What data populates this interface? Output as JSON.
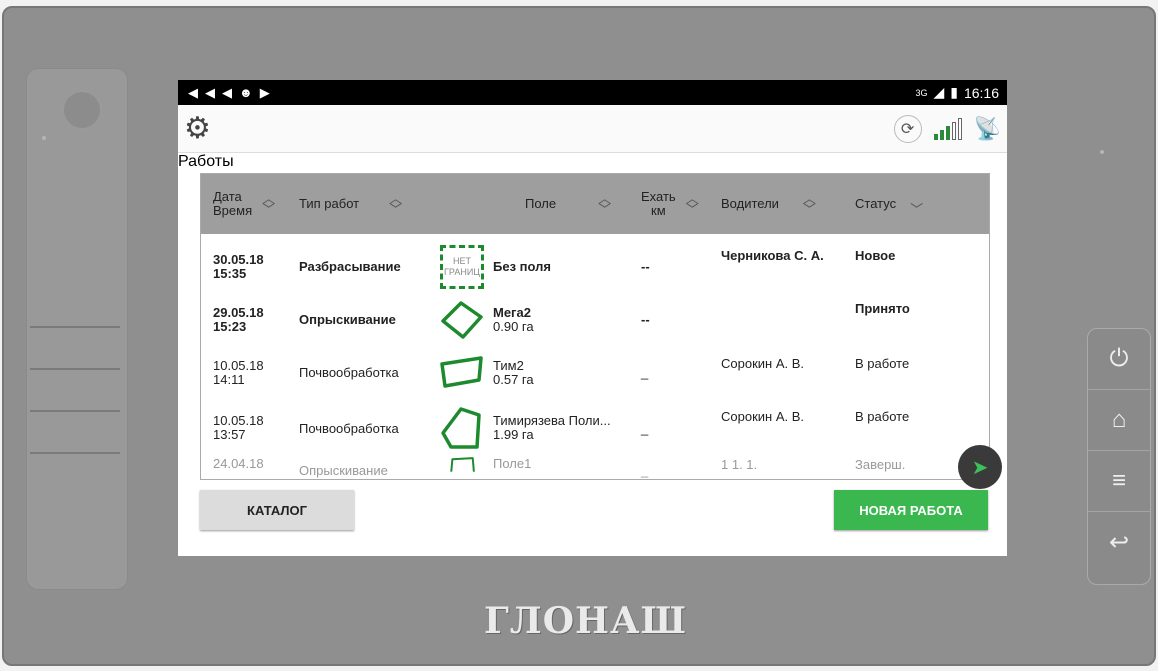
{
  "status_bar": {
    "left_icons": [
      "◀",
      "◀",
      "◀",
      "☻",
      "▶"
    ],
    "network": "3G",
    "time": "16:16"
  },
  "app_bar": {
    "title": "Работы",
    "settings_icon": "gear-icon",
    "sync_icon": "sync-icon",
    "signal_icon": "signal-strength-icon",
    "satellite_icon": "satellite-icon"
  },
  "table": {
    "headers": [
      {
        "label": "Дата\nВремя"
      },
      {
        "label": "Тип работ"
      },
      {
        "label": "Поле"
      },
      {
        "label": "Ехать\nкм"
      },
      {
        "label": "Водители"
      },
      {
        "label": "Статус"
      }
    ],
    "rows": [
      {
        "date": "30.05.18",
        "time": "15:35",
        "type": "Разбрасывание",
        "field_shape_label": "НЕТ ГРАНИЦ",
        "field": "Без поля",
        "area": "",
        "km": "--",
        "drivers": "Черникова С. А.",
        "status": "Новое",
        "bold": true
      },
      {
        "date": "29.05.18",
        "time": "15:23",
        "type": "Опрыскивание",
        "field_shape_label": "",
        "field": "Мега2",
        "area": "0.90 га",
        "km": "--",
        "drivers": "",
        "status": "Принято",
        "bold": true
      },
      {
        "date": "10.05.18",
        "time": "14:11",
        "type": "Почвообработка",
        "field_shape_label": "",
        "field": "Тим2",
        "area": "0.57 га",
        "km": "_",
        "drivers": "Сорокин А. В.",
        "status": "В работе",
        "bold": false
      },
      {
        "date": "10.05.18",
        "time": "13:57",
        "type": "Почвообработка",
        "field_shape_label": "",
        "field": "Тимирязева Поли...",
        "area": "1.99 га",
        "km": "_",
        "drivers": "Сорокин А. В.",
        "status": "В работе",
        "bold": false
      },
      {
        "date": "24.04.18",
        "time": "",
        "type": "Опрыскивание",
        "field_shape_label": "",
        "field": "Поле1",
        "area": "",
        "km": "_",
        "drivers": "1 1. 1.",
        "status": "Заверш.",
        "bold": false
      }
    ]
  },
  "buttons": {
    "catalog": "КАТАЛОГ",
    "new_work": "НОВАЯ РАБОТА"
  },
  "device": {
    "brand": "ГЛОНАШ",
    "side_buttons": [
      "power-icon",
      "home-icon",
      "menu-icon",
      "back-icon"
    ]
  },
  "colors": {
    "accent_green": "#3ab74f",
    "field_outline": "#1e8a2e",
    "header_bg": "#9e9e9e"
  }
}
